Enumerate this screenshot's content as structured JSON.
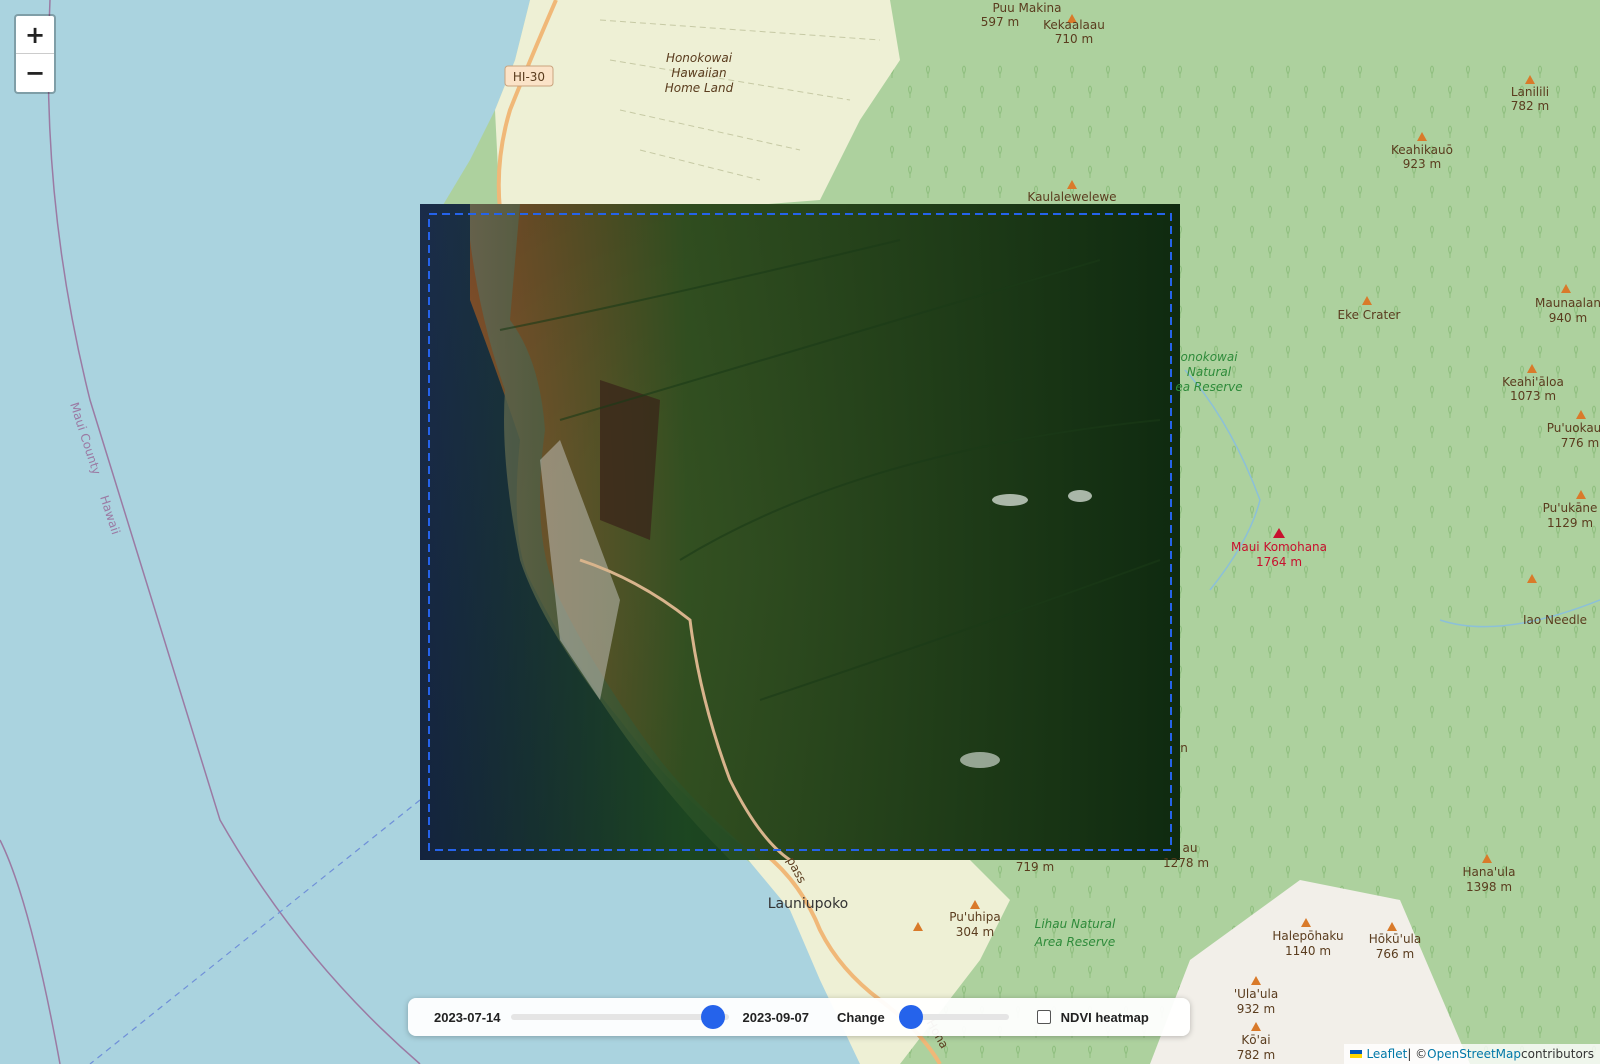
{
  "map": {
    "labels": {
      "puu_makina": "Puu Makina",
      "puu_makina_elev": "597 m",
      "kekaalaau": "Kekaalaau",
      "kekaalaau_elev": "710 m",
      "honokowai_1": "Honokowai",
      "honokowai_2": "Hawaiian",
      "honokowai_3": "Home Land",
      "hi30": "HI-30",
      "lanilili": "Lanilili",
      "lanilili_elev": "782 m",
      "keahikauo": "Keahikauō",
      "keahikauo_elev": "923 m",
      "kaulalewelewe": "Kaulalewelewe",
      "eke_crater": "Eke Crater",
      "maunaalani": "Maunaalan",
      "maunaalani_elev": "940 m",
      "nr_1": "onokowai",
      "nr_2": "Natural",
      "nr_3": "ea Reserve",
      "keahialoa": "Keahi'āloa",
      "keahialoa_elev": "1073 m",
      "puuokau": "Pu'uokau",
      "puuokau_elev": "776 m",
      "puukane": "Pu'ukāne",
      "puukane_elev": "1129 m",
      "maui_komohana": "Maui Komohana",
      "maui_komohana_elev": "1764 m",
      "iao_needle": "Iao Needle",
      "maui_county": "Maui County",
      "hawaii": "Hawaii",
      "launiupoko": "Launiupoko",
      "puuhipa": "Pu'uhipa",
      "puuhipa_elev": "304 m",
      "lihau_1": "Lihau Natural",
      "lihau_2": "Area Reserve",
      "elev_719": "719 m",
      "lihau_peak": "au",
      "lihau_elev": "1278 m",
      "halepohaku": "Halepōhaku",
      "halepohaku_elev": "1140 m",
      "hokuula": "Hōkū'ula",
      "hokuula_elev": "766 m",
      "hanaula": "Hana'ula",
      "hanaula_elev": "1398 m",
      "ulaula": "'Ula'ula",
      "ulaula_elev": "932 m",
      "koai": "Kō'ai",
      "koai_elev": "782 m",
      "edge_m": "n",
      "road_pass": "pass",
      "road_hona": "Hona"
    },
    "colors": {
      "water": "#aad3df",
      "forest": "#add19e",
      "farmland": "#eef0d5",
      "bare": "#f2efe9",
      "road": "#f0b878",
      "aoi_border": "#2563eb"
    }
  },
  "zoom": {
    "in_label": "+",
    "out_label": "−"
  },
  "controls": {
    "start_date": "2023-07-14",
    "end_date": "2023-09-07",
    "date_slider_position": 0.98,
    "change_label": "Change",
    "change_slider_position": 0.0,
    "ndvi_label": "NDVI heatmap",
    "ndvi_checked": false
  },
  "attribution": {
    "leaflet": "Leaflet",
    "separator": " | © ",
    "osm": "OpenStreetMap",
    "contributors": " contributors"
  }
}
